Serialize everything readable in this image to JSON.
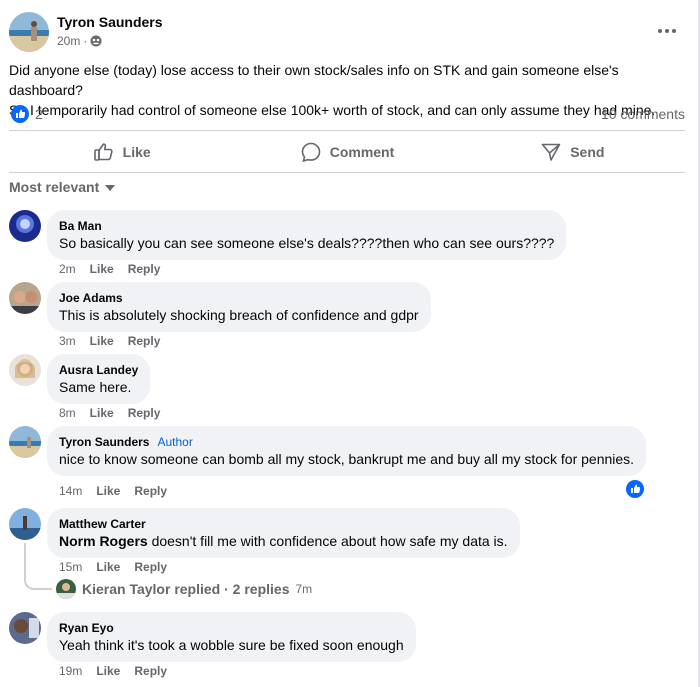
{
  "post": {
    "author": "Tyron Saunders",
    "time": "20m",
    "separator": "·",
    "text_line1": "Did anyone else (today) lose access to their own stock/sales info on STK and gain someone else's dashboard?",
    "text_line2": "So I temporarily had control of someone else 100k+ worth of stock, and can only assume they had mine.",
    "reaction_count": "2",
    "comments_count": "10 comments"
  },
  "actions": {
    "like": "Like",
    "comment": "Comment",
    "send": "Send"
  },
  "sort": {
    "label": "Most relevant"
  },
  "comments": [
    {
      "name": "Ba Man",
      "text": "So basically you can see someone else's deals????then who can see ours????",
      "time": "2m",
      "like": "Like",
      "reply": "Reply"
    },
    {
      "name": "Joe Adams",
      "text": "This is absolutely shocking breach of confidence and gdpr",
      "time": "3m",
      "like": "Like",
      "reply": "Reply"
    },
    {
      "name": "Ausra Landey",
      "text": "Same here.",
      "time": "8m",
      "like": "Like",
      "reply": "Reply"
    },
    {
      "name": "Tyron Saunders",
      "badge": "Author",
      "text": "nice to know someone can bomb all my stock, bankrupt me and buy all my stock for pennies.",
      "time": "14m",
      "like": "Like",
      "reply": "Reply"
    },
    {
      "name": "Matthew Carter",
      "mention": "Norm Rogers",
      "text": " doesn't fill me with confidence about how safe my data is.",
      "time": "15m",
      "like": "Like",
      "reply": "Reply"
    },
    {
      "name": "Ryan Eyo",
      "text": "Yeah think it's took a wobble sure be fixed soon enough",
      "time": "19m",
      "like": "Like",
      "reply": "Reply"
    }
  ],
  "replies": {
    "text": "Kieran Taylor replied · 2 replies",
    "time": "7m"
  },
  "colors": {
    "accent": "#0866ff",
    "muted": "#65676b",
    "bubble": "#f0f2f5"
  }
}
